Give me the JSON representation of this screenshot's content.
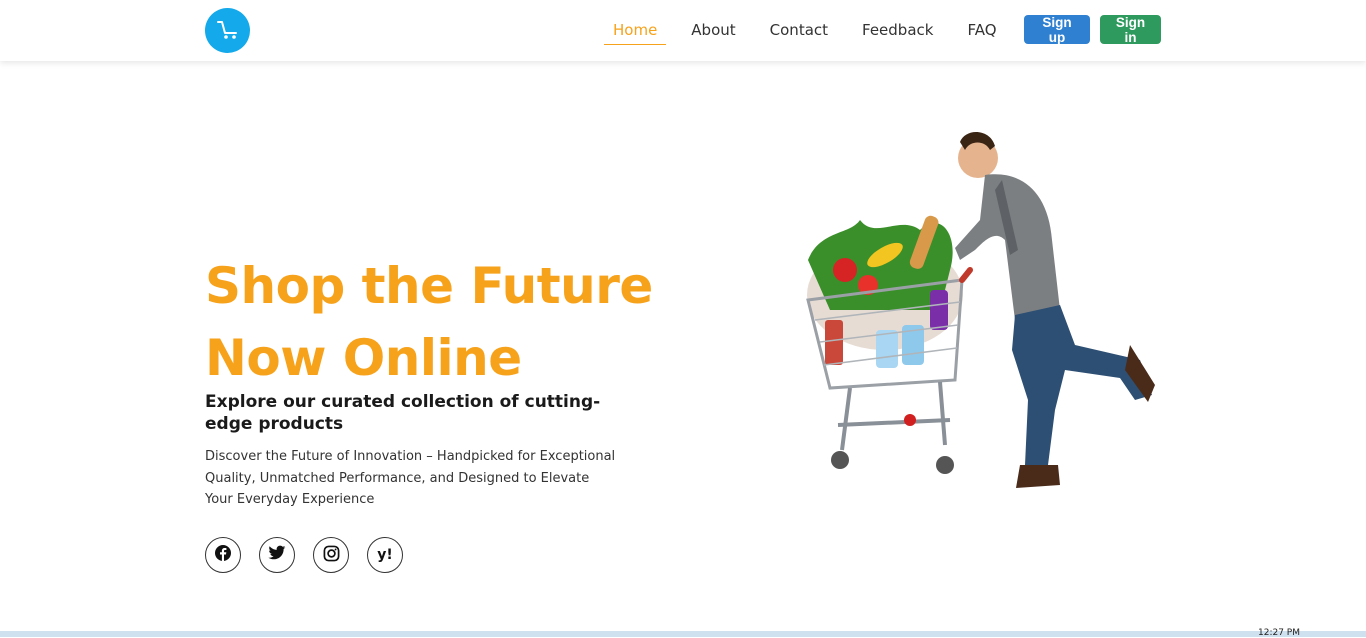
{
  "nav": {
    "items": [
      {
        "label": "Home",
        "active": true
      },
      {
        "label": "About",
        "active": false
      },
      {
        "label": "Contact",
        "active": false
      },
      {
        "label": "Feedback",
        "active": false
      },
      {
        "label": "FAQ",
        "active": false
      }
    ],
    "signup_label": "Sign up",
    "signin_label": "Sign in",
    "logo_icon": "shopping-cart-icon"
  },
  "hero": {
    "title_line1": "Shop the Future",
    "title_line2": "Now Online",
    "subtitle": "Explore our curated collection of cutting-edge products",
    "description": "Discover the Future of Innovation – Handpicked for Exceptional Quality, Unmatched Performance, and Designed to Elevate Your Everyday Experience",
    "socials": [
      "facebook-icon",
      "twitter-icon",
      "instagram-icon",
      "yahoo-icon"
    ],
    "yahoo_glyph": "y!"
  },
  "taskbar": {
    "clock": "12:27 PM"
  },
  "colors": {
    "accent": "#f7a21b",
    "logo_bg": "#13a9ea",
    "signup_bg": "#2f80d1",
    "signin_bg": "#2e9a5e"
  }
}
